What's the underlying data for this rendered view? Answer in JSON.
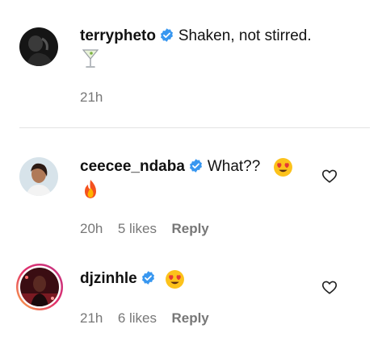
{
  "comments": [
    {
      "username": "terrypheto",
      "verified": true,
      "text": "Shaken, not stirred.",
      "emoji_line": "🍸",
      "time": "21h",
      "likes": "",
      "reply": ""
    },
    {
      "username": "ceecee_ndaba",
      "verified": true,
      "text": "What??",
      "emoji_inline": "😍",
      "emoji_line": "🔥",
      "time": "20h",
      "likes": "5 likes",
      "reply": "Reply"
    },
    {
      "username": "djzinhle",
      "verified": true,
      "text": "",
      "emoji_inline": "😍",
      "time": "21h",
      "likes": "6 likes",
      "reply": "Reply"
    }
  ],
  "colors": {
    "verified_blue": "#3897f0",
    "meta_gray": "#777777",
    "divider": "#e3e3e3",
    "story_ring_start": "#c13584",
    "story_ring_end": "#fcaf45"
  },
  "icons": {
    "verified": "verified-badge-icon",
    "like": "heart-outline-icon"
  }
}
